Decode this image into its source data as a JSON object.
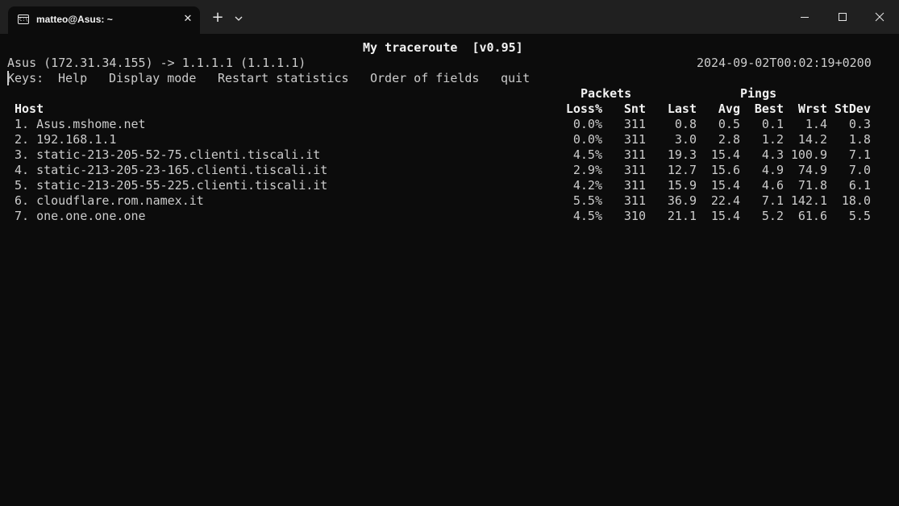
{
  "window": {
    "tab_title": "matteo@Asus: ~",
    "tab_icon_text": "C:\\",
    "tab_close_glyph": "✕",
    "new_tab_glyph": "+"
  },
  "mtr": {
    "title": "My traceroute  [v0.95]",
    "route": "Asus (172.31.34.155) -> 1.1.1.1 (1.1.1.1)",
    "timestamp": "2024-09-02T00:02:19+0200",
    "keys_label": "Keys:",
    "keys": [
      "Help",
      "Display mode",
      "Restart statistics",
      "Order of fields",
      "quit"
    ],
    "group_headers": {
      "packets": "Packets",
      "pings": "Pings"
    },
    "columns": {
      "host": "Host",
      "loss": "Loss%",
      "snt": "Snt",
      "last": "Last",
      "avg": "Avg",
      "best": "Best",
      "wrst": "Wrst",
      "stdev": "StDev"
    },
    "rows": [
      {
        "host": "1. Asus.mshome.net",
        "loss": "0.0%",
        "snt": "311",
        "last": "0.8",
        "avg": "0.5",
        "best": "0.1",
        "wrst": "1.4",
        "stdev": "0.3"
      },
      {
        "host": "2. 192.168.1.1",
        "loss": "0.0%",
        "snt": "311",
        "last": "3.0",
        "avg": "2.8",
        "best": "1.2",
        "wrst": "14.2",
        "stdev": "1.8"
      },
      {
        "host": "3. static-213-205-52-75.clienti.tiscali.it",
        "loss": "4.5%",
        "snt": "311",
        "last": "19.3",
        "avg": "15.4",
        "best": "4.3",
        "wrst": "100.9",
        "stdev": "7.1"
      },
      {
        "host": "4. static-213-205-23-165.clienti.tiscali.it",
        "loss": "2.9%",
        "snt": "311",
        "last": "12.7",
        "avg": "15.6",
        "best": "4.9",
        "wrst": "74.9",
        "stdev": "7.0"
      },
      {
        "host": "5. static-213-205-55-225.clienti.tiscali.it",
        "loss": "4.2%",
        "snt": "311",
        "last": "15.9",
        "avg": "15.4",
        "best": "4.6",
        "wrst": "71.8",
        "stdev": "6.1"
      },
      {
        "host": "6. cloudflare.rom.namex.it",
        "loss": "5.5%",
        "snt": "311",
        "last": "36.9",
        "avg": "22.4",
        "best": "7.1",
        "wrst": "142.1",
        "stdev": "18.0"
      },
      {
        "host": "7. one.one.one.one",
        "loss": "4.5%",
        "snt": "310",
        "last": "21.1",
        "avg": "15.4",
        "best": "5.2",
        "wrst": "61.6",
        "stdev": "5.5"
      }
    ]
  },
  "colors": {
    "terminal_bg": "#0c0c0c",
    "titlebar_bg": "#202020",
    "text": "#cccccc",
    "bold_text": "#f2f2f2"
  }
}
